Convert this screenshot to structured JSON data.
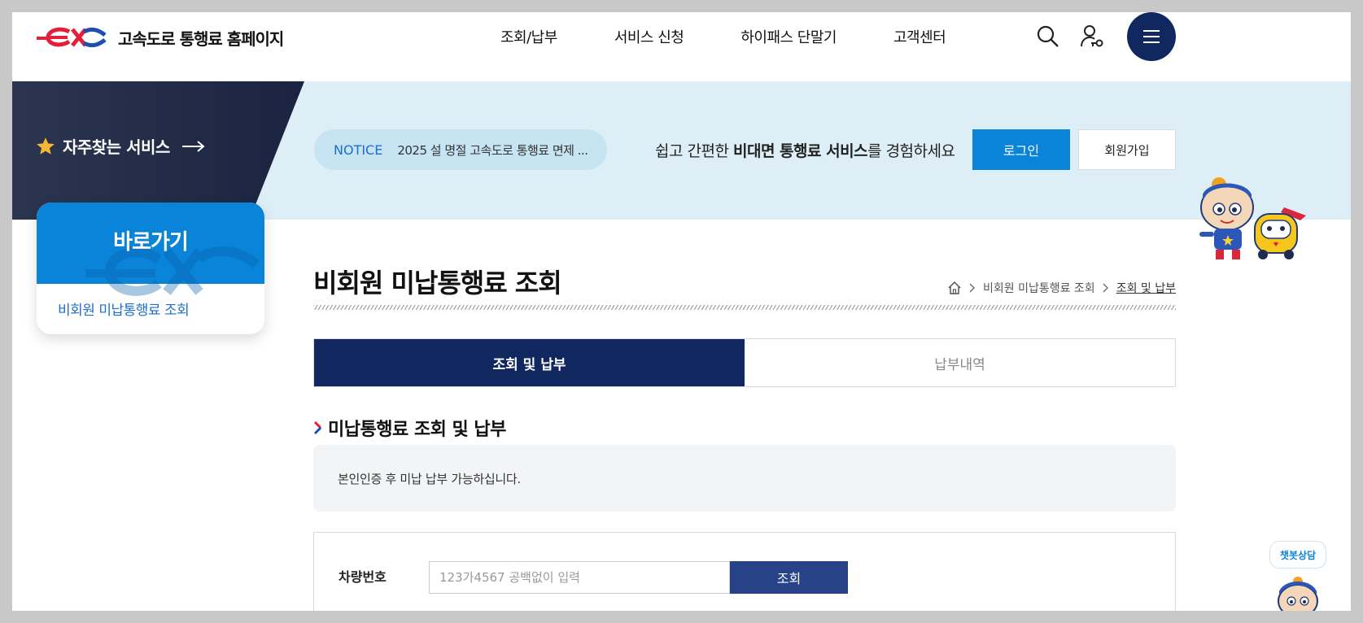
{
  "header": {
    "site_title": "고속도로 통행료 홈페이지",
    "nav": [
      "조회/납부",
      "서비스 신청",
      "하이패스 단말기",
      "고객센터"
    ]
  },
  "banner": {
    "favorites_label": "자주찾는 서비스",
    "notice_tag": "NOTICE",
    "notice_text": "2025 설 명절 고속도로 통행료 면제 ...",
    "promo_before": "쉽고 간편한 ",
    "promo_bold": "비대면 통행료 서비스",
    "promo_after": "를 경험하세요",
    "login_label": "로그인",
    "join_label": "회원가입"
  },
  "sidebar": {
    "title": "바로가기",
    "link": "비회원 미납통행료 조회"
  },
  "main": {
    "page_title": "비회원 미납통행료 조회",
    "breadcrumb": [
      "비회원 미납통행료 조회",
      "조회 및 납부"
    ],
    "tabs": [
      "조회 및 납부",
      "납부내역"
    ],
    "section_title": "미납통행료 조회 및 납부",
    "info_text": "본인인증 후 미납 납부 가능하십니다.",
    "plate_label": "차량번호",
    "plate_placeholder": "123가4567 공백없이 입력",
    "search_label": "조회"
  },
  "chatbot": {
    "label": "챗봇상담"
  },
  "colors": {
    "brand_navy": "#10275f",
    "brand_blue": "#0a84d8",
    "brand_red": "#e51f3a",
    "banner_bg": "#ddeef7"
  },
  "icons": [
    "search-icon",
    "user-key-icon",
    "menu-icon",
    "star-icon",
    "arrow-right-icon",
    "home-icon",
    "chevron-right-icon"
  ]
}
